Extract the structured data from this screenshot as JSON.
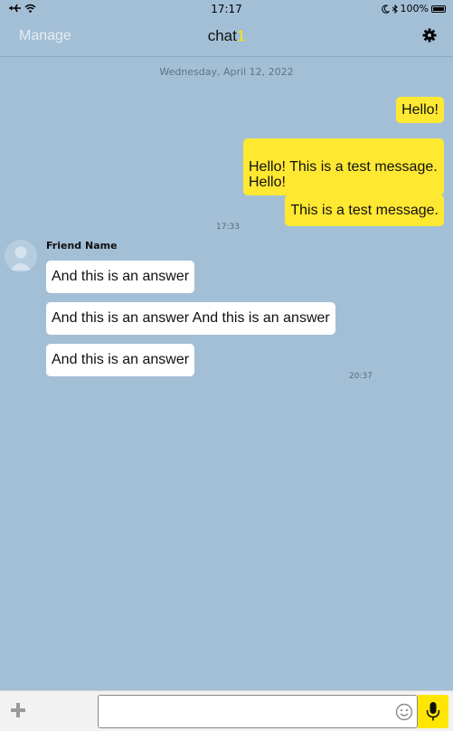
{
  "status_bar": {
    "time": "17:17",
    "battery_text": "100%",
    "icons": [
      "airplane-icon",
      "wifi-icon",
      "moon-icon",
      "bluetooth-icon",
      "battery-icon"
    ]
  },
  "nav": {
    "manage_label": "Manage",
    "title": "chat",
    "title_badge": "1",
    "settings_icon": "gear-icon"
  },
  "chat": {
    "date_separator": "Wednesday, April 12, 2022",
    "outgoing": [
      {
        "text": "Hello!"
      },
      {
        "text": "Hello! This is a test message.\nHello!"
      },
      {
        "text": "This is a test message."
      }
    ],
    "outgoing_time": "17:33",
    "friend_name": "Friend Name",
    "incoming": [
      {
        "text": "And this is an answer"
      },
      {
        "text": "And this is an answer And this is an answer"
      },
      {
        "text": "And this is an answer"
      }
    ],
    "incoming_time": "20:37"
  },
  "composer": {
    "input_value": "",
    "input_placeholder": "",
    "add_icon": "plus-icon",
    "emoji_icon": "smiley-icon",
    "mic_icon": "microphone-icon"
  },
  "colors": {
    "background": "#a3bfd6",
    "outgoing_bubble": "#ffe832",
    "incoming_bubble": "#ffffff",
    "accent": "#ffe600"
  }
}
